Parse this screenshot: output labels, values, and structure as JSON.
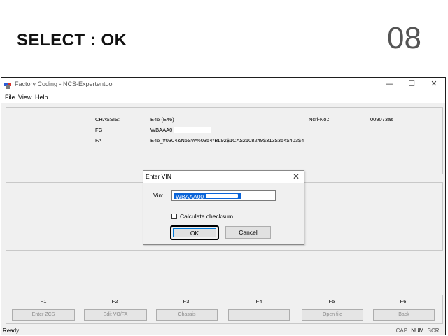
{
  "slide": {
    "title": "SELECT : OK",
    "number": "08"
  },
  "window": {
    "title": "Factory Coding - NCS-Expertentool",
    "controls": {
      "minimize": "—",
      "maximize": "☐",
      "close": "✕"
    },
    "menu": [
      "File",
      "View",
      "Help"
    ]
  },
  "vehicle_info": {
    "chassis_label": "CHASSIS:",
    "chassis_value": "E46 (E46)",
    "fg_label": "FG",
    "fg_value": "WBAAA0",
    "fa_label": "FA",
    "fa_value": "E46_#0304&N5SW%0354*BL92$1CA$2108249$313$354$403$4",
    "ncrl_label": "Ncrl-No.:",
    "ncrl_value": "009073as"
  },
  "function_keys": [
    {
      "key": "F1",
      "label": "Enter ZCS"
    },
    {
      "key": "F2",
      "label": "Edit VO/FA"
    },
    {
      "key": "F3",
      "label": "Chassis"
    },
    {
      "key": "F4",
      "label": ""
    },
    {
      "key": "F5",
      "label": "Open file"
    },
    {
      "key": "F6",
      "label": "Back"
    }
  ],
  "status": {
    "left": "Ready",
    "cap": "CAP",
    "num": "NUM",
    "scrl": "SCRL"
  },
  "dialog": {
    "title": "Enter VIN",
    "close_glyph": "✕",
    "vin_label": "Vin:",
    "vin_value": "WBAAA00",
    "checkbox_label": "Calculate checksum",
    "checkbox_checked": false,
    "ok_label": "OK",
    "cancel_label": "Cancel"
  }
}
